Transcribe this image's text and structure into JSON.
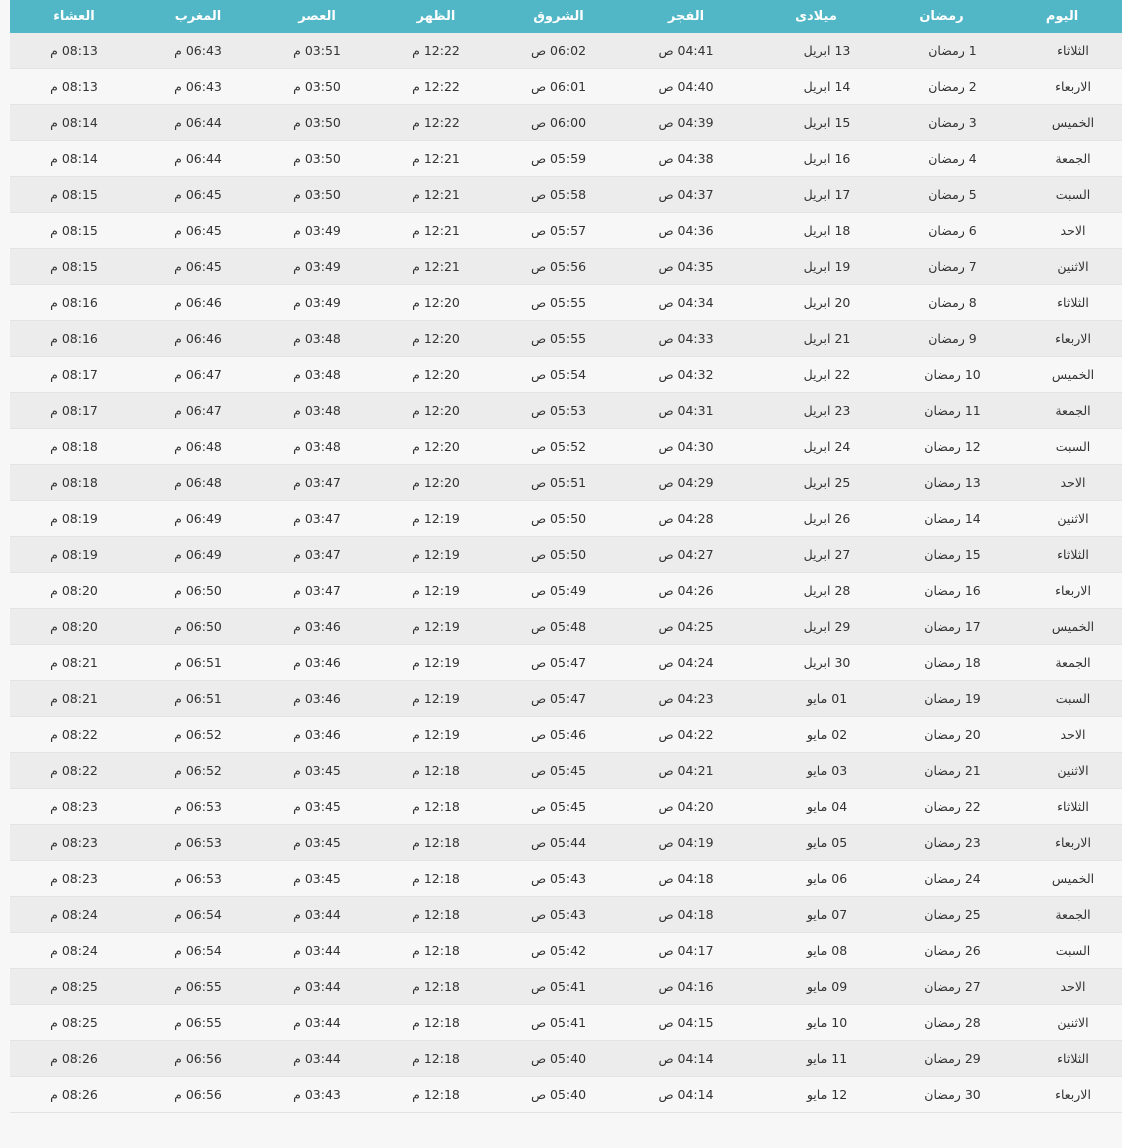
{
  "headers": [
    "اليوم",
    "رمضان",
    "ميلادى",
    "الفجر",
    "الشروق",
    "الظهر",
    "العصر",
    "المغرب",
    "العشاء"
  ],
  "rows": [
    [
      "الثلاثاء",
      "1 رمضان",
      "13 ابريل",
      "04:41 ص",
      "06:02 ص",
      "12:22 م",
      "03:51 م",
      "06:43 م",
      "08:13 م"
    ],
    [
      "الاربعاء",
      "2 رمضان",
      "14 ابريل",
      "04:40 ص",
      "06:01 ص",
      "12:22 م",
      "03:50 م",
      "06:43 م",
      "08:13 م"
    ],
    [
      "الخميس",
      "3 رمضان",
      "15 ابريل",
      "04:39 ص",
      "06:00 ص",
      "12:22 م",
      "03:50 م",
      "06:44 م",
      "08:14 م"
    ],
    [
      "الجمعة",
      "4 رمضان",
      "16 ابريل",
      "04:38 ص",
      "05:59 ص",
      "12:21 م",
      "03:50 م",
      "06:44 م",
      "08:14 م"
    ],
    [
      "السبت",
      "5 رمضان",
      "17 ابريل",
      "04:37 ص",
      "05:58 ص",
      "12:21 م",
      "03:50 م",
      "06:45 م",
      "08:15 م"
    ],
    [
      "الاحد",
      "6 رمضان",
      "18 ابريل",
      "04:36 ص",
      "05:57 ص",
      "12:21 م",
      "03:49 م",
      "06:45 م",
      "08:15 م"
    ],
    [
      "الاثنين",
      "7 رمضان",
      "19 ابريل",
      "04:35 ص",
      "05:56 ص",
      "12:21 م",
      "03:49 م",
      "06:45 م",
      "08:15 م"
    ],
    [
      "الثلاثاء",
      "8 رمضان",
      "20 ابريل",
      "04:34 ص",
      "05:55 ص",
      "12:20 م",
      "03:49 م",
      "06:46 م",
      "08:16 م"
    ],
    [
      "الاربعاء",
      "9 رمضان",
      "21 ابريل",
      "04:33 ص",
      "05:55 ص",
      "12:20 م",
      "03:48 م",
      "06:46 م",
      "08:16 م"
    ],
    [
      "الخميس",
      "10 رمضان",
      "22 ابريل",
      "04:32 ص",
      "05:54 ص",
      "12:20 م",
      "03:48 م",
      "06:47 م",
      "08:17 م"
    ],
    [
      "الجمعة",
      "11 رمضان",
      "23 ابريل",
      "04:31 ص",
      "05:53 ص",
      "12:20 م",
      "03:48 م",
      "06:47 م",
      "08:17 م"
    ],
    [
      "السبت",
      "12 رمضان",
      "24 ابريل",
      "04:30 ص",
      "05:52 ص",
      "12:20 م",
      "03:48 م",
      "06:48 م",
      "08:18 م"
    ],
    [
      "الاحد",
      "13 رمضان",
      "25 ابريل",
      "04:29 ص",
      "05:51 ص",
      "12:20 م",
      "03:47 م",
      "06:48 م",
      "08:18 م"
    ],
    [
      "الاثنين",
      "14 رمضان",
      "26 ابريل",
      "04:28 ص",
      "05:50 ص",
      "12:19 م",
      "03:47 م",
      "06:49 م",
      "08:19 م"
    ],
    [
      "الثلاثاء",
      "15 رمضان",
      "27 ابريل",
      "04:27 ص",
      "05:50 ص",
      "12:19 م",
      "03:47 م",
      "06:49 م",
      "08:19 م"
    ],
    [
      "الاربعاء",
      "16 رمضان",
      "28 ابريل",
      "04:26 ص",
      "05:49 ص",
      "12:19 م",
      "03:47 م",
      "06:50 م",
      "08:20 م"
    ],
    [
      "الخميس",
      "17 رمضان",
      "29 ابريل",
      "04:25 ص",
      "05:48 ص",
      "12:19 م",
      "03:46 م",
      "06:50 م",
      "08:20 م"
    ],
    [
      "الجمعة",
      "18 رمضان",
      "30 ابريل",
      "04:24 ص",
      "05:47 ص",
      "12:19 م",
      "03:46 م",
      "06:51 م",
      "08:21 م"
    ],
    [
      "السبت",
      "19 رمضان",
      "01 مايو",
      "04:23 ص",
      "05:47 ص",
      "12:19 م",
      "03:46 م",
      "06:51 م",
      "08:21 م"
    ],
    [
      "الاحد",
      "20 رمضان",
      "02 مايو",
      "04:22 ص",
      "05:46 ص",
      "12:19 م",
      "03:46 م",
      "06:52 م",
      "08:22 م"
    ],
    [
      "الاثنين",
      "21 رمضان",
      "03 مايو",
      "04:21 ص",
      "05:45 ص",
      "12:18 م",
      "03:45 م",
      "06:52 م",
      "08:22 م"
    ],
    [
      "الثلاثاء",
      "22 رمضان",
      "04 مايو",
      "04:20 ص",
      "05:45 ص",
      "12:18 م",
      "03:45 م",
      "06:53 م",
      "08:23 م"
    ],
    [
      "الاربعاء",
      "23 رمضان",
      "05 مايو",
      "04:19 ص",
      "05:44 ص",
      "12:18 م",
      "03:45 م",
      "06:53 م",
      "08:23 م"
    ],
    [
      "الخميس",
      "24 رمضان",
      "06 مايو",
      "04:18 ص",
      "05:43 ص",
      "12:18 م",
      "03:45 م",
      "06:53 م",
      "08:23 م"
    ],
    [
      "الجمعة",
      "25 رمضان",
      "07 مايو",
      "04:18 ص",
      "05:43 ص",
      "12:18 م",
      "03:44 م",
      "06:54 م",
      "08:24 م"
    ],
    [
      "السبت",
      "26 رمضان",
      "08 مايو",
      "04:17 ص",
      "05:42 ص",
      "12:18 م",
      "03:44 م",
      "06:54 م",
      "08:24 م"
    ],
    [
      "الاحد",
      "27 رمضان",
      "09 مايو",
      "04:16 ص",
      "05:41 ص",
      "12:18 م",
      "03:44 م",
      "06:55 م",
      "08:25 م"
    ],
    [
      "الاثنين",
      "28 رمضان",
      "10 مايو",
      "04:15 ص",
      "05:41 ص",
      "12:18 م",
      "03:44 م",
      "06:55 م",
      "08:25 م"
    ],
    [
      "الثلاثاء",
      "29 رمضان",
      "11 مايو",
      "04:14 ص",
      "05:40 ص",
      "12:18 م",
      "03:44 م",
      "06:56 م",
      "08:26 م"
    ],
    [
      "الاربعاء",
      "30 رمضان",
      "12 مايو",
      "04:14 ص",
      "05:40 ص",
      "12:18 م",
      "03:43 م",
      "06:56 م",
      "08:26 م"
    ]
  ]
}
